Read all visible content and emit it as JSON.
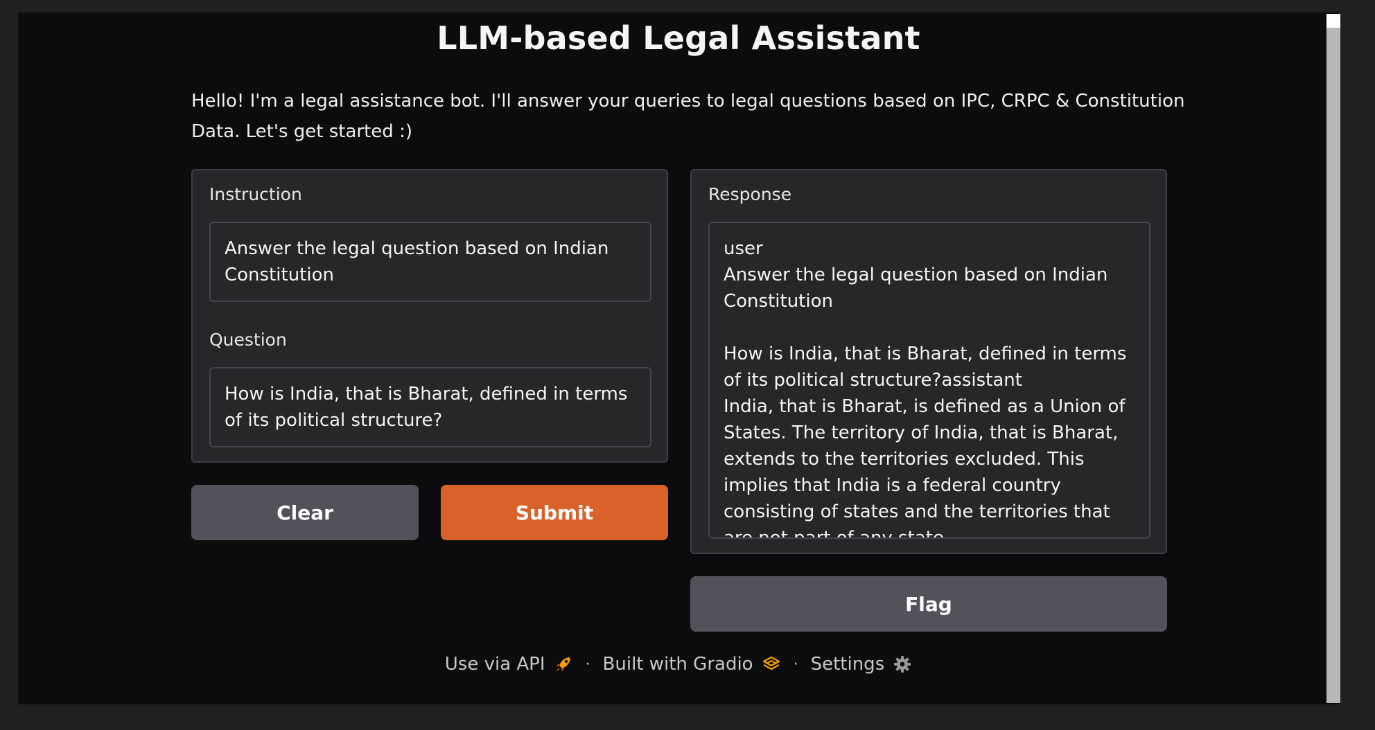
{
  "app": {
    "title": "LLM-based Legal Assistant",
    "description": "Hello! I'm a legal assistance bot. I'll answer your queries to legal questions based on IPC, CRPC & Constitution Data. Let's get started :)"
  },
  "inputs": {
    "instruction": {
      "label": "Instruction",
      "value": "Answer the legal question based on Indian Constitution"
    },
    "question": {
      "label": "Question",
      "value": "How is India, that is Bharat, defined in terms of its political structure?"
    }
  },
  "buttons": {
    "clear": "Clear",
    "submit": "Submit",
    "flag": "Flag"
  },
  "output": {
    "label": "Response",
    "value": "user\nAnswer the legal question based on Indian Constitution\n\nHow is India, that is Bharat, defined in terms of its political structure?assistant\nIndia, that is Bharat, is defined as a Union of States. The territory of India, that is Bharat, extends to the territories excluded. This implies that India is a federal country consisting of states and the territories that are not part of any state."
  },
  "footer": {
    "api": "Use via API",
    "separator": "·",
    "built_with": "Built with Gradio",
    "settings": "Settings",
    "icons": [
      "rocket-icon",
      "gradio-logo-icon",
      "gear-icon"
    ]
  },
  "colors": {
    "background": "#0c0c0f",
    "panel": "#27272a",
    "primary": "#d9622b",
    "secondary": "#52525b",
    "accent_icon": "#f59e0b"
  }
}
